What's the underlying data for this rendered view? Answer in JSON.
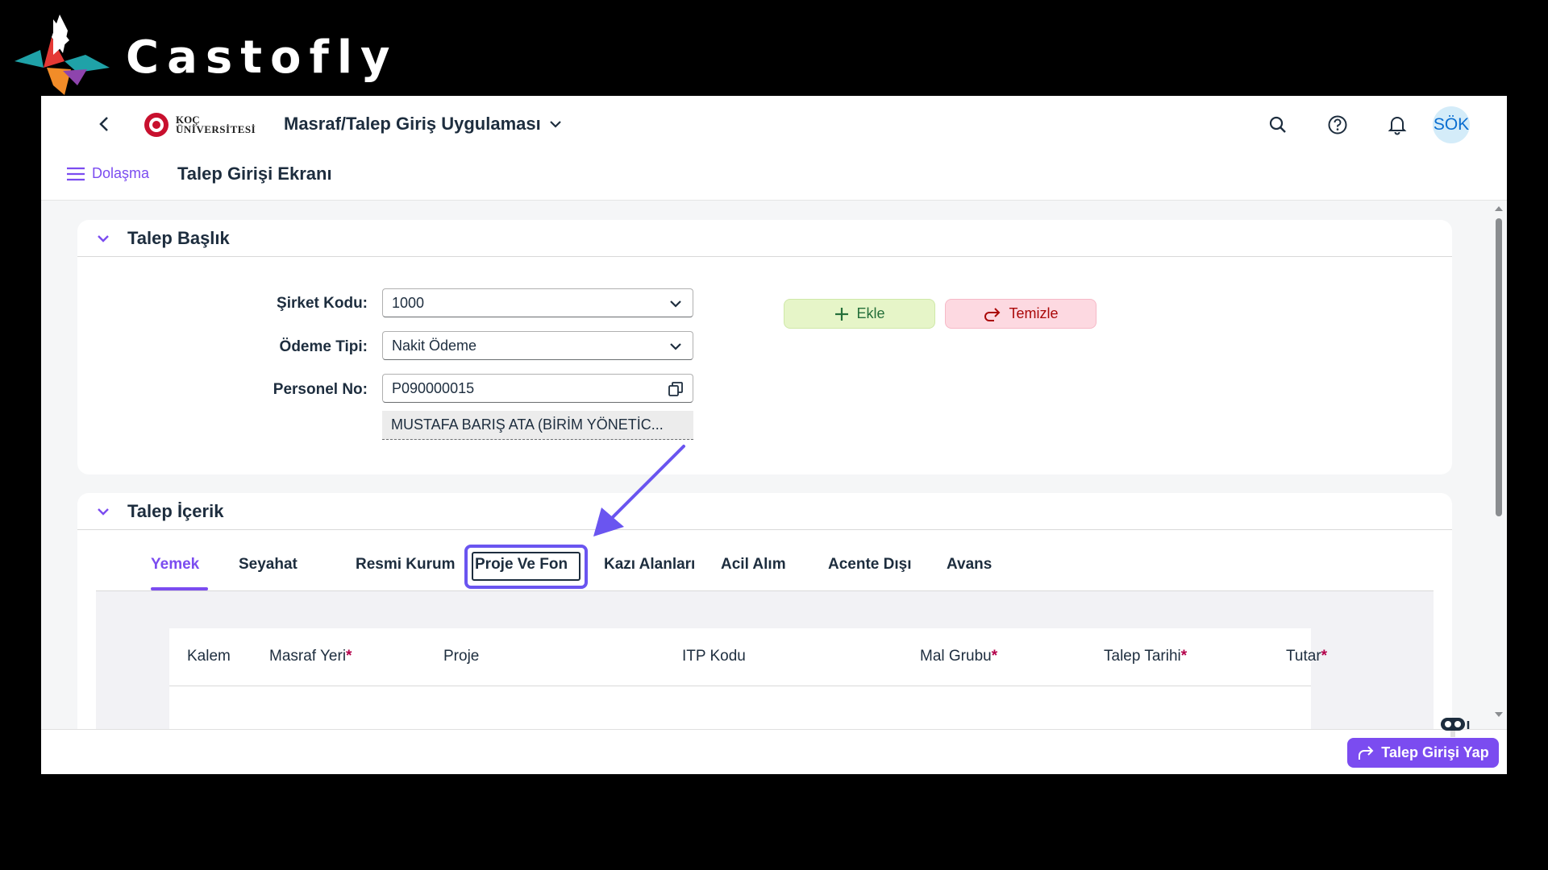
{
  "watermark": {
    "text": "Castofly"
  },
  "shellbar": {
    "logo_line1": "KOÇ",
    "logo_line2": "ÜNİVERSİTESİ",
    "app_title": "Masraf/Talep Giriş Uygulaması",
    "avatar": "SÖK",
    "icons": [
      "search-icon",
      "help-icon",
      "bell-icon"
    ]
  },
  "subheader": {
    "nav_label": "Dolaşma",
    "page_title": "Talep Girişi Ekranı"
  },
  "talep_baslik": {
    "title": "Talep Başlık",
    "sirket_kodu_label": "Şirket Kodu:",
    "sirket_kodu_value": "1000",
    "odeme_tipi_label": "Ödeme Tipi:",
    "odeme_tipi_value": "Nakit Ödeme",
    "personel_no_label": "Personel No:",
    "personel_no_value": "P090000015",
    "personel_name": "MUSTAFA BARIŞ  ATA (BİRİM YÖNETİC...",
    "add_label": "Ekle",
    "clear_label": "Temizle"
  },
  "talep_icerik": {
    "title": "Talep İçerik",
    "tabs": [
      "Yemek",
      "Seyahat",
      "Resmi Kurum",
      "Proje Ve Fon",
      "Kazı Alanları",
      "Acil Alım",
      "Acente Dışı",
      "Avans"
    ],
    "active_tab": "Yemek",
    "highlighted_tab": "Proje Ve Fon",
    "columns": [
      {
        "label": "Kalem",
        "required": false
      },
      {
        "label": "Masraf Yeri",
        "required": true
      },
      {
        "label": "Proje",
        "required": false
      },
      {
        "label": "ITP Kodu",
        "required": false
      },
      {
        "label": "Mal Grubu",
        "required": true
      },
      {
        "label": "Talep Tarihi",
        "required": true
      },
      {
        "label": "Tutar",
        "required": true
      }
    ],
    "required_marker": "*"
  },
  "footer": {
    "submit_label": "Talep Girişi Yap"
  },
  "colors": {
    "accent": "#7b4cf0",
    "add_bg": "#e6f5c8",
    "clear_bg": "#fdd9e1",
    "required": "#b3004a"
  }
}
